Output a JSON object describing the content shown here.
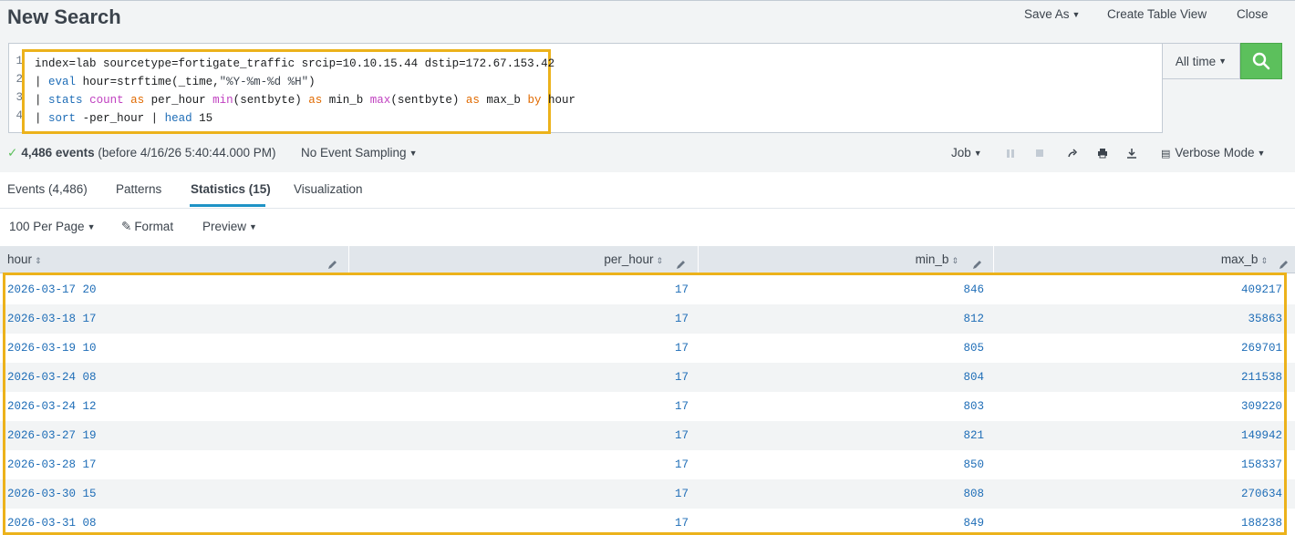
{
  "header": {
    "title": "New Search",
    "save_as": "Save As",
    "create_table_view": "Create Table View",
    "close": "Close"
  },
  "search": {
    "line_numbers": [
      "1",
      "2",
      "3",
      "4"
    ],
    "query_lines": [
      "index=lab sourcetype=fortigate_traffic srcip=10.10.15.44 dstip=172.67.153.42",
      "| eval hour=strftime(_time,\"%Y-%m-%d %H\")",
      "| stats count as per_hour min(sentbyte) as min_b max(sentbyte) as max_b by hour",
      "| sort -per_hour | head 15"
    ],
    "time_range": "All time"
  },
  "status": {
    "event_count": "4,486 events",
    "before": "(before 4/16/26 5:40:44.000 PM)",
    "sampling": "No Event Sampling",
    "job": "Job",
    "mode": "Verbose Mode"
  },
  "tabs": [
    {
      "label": "Events (4,486)",
      "active": false
    },
    {
      "label": "Patterns",
      "active": false
    },
    {
      "label": "Statistics (15)",
      "active": true
    },
    {
      "label": "Visualization",
      "active": false
    }
  ],
  "table_options": {
    "per_page": "100 Per Page",
    "format": "Format",
    "preview": "Preview"
  },
  "table": {
    "columns": [
      "hour",
      "per_hour",
      "min_b",
      "max_b"
    ],
    "rows": [
      [
        "2026-03-17 20",
        "17",
        "846",
        "409217"
      ],
      [
        "2026-03-18 17",
        "17",
        "812",
        "35863"
      ],
      [
        "2026-03-19 10",
        "17",
        "805",
        "269701"
      ],
      [
        "2026-03-24 08",
        "17",
        "804",
        "211538"
      ],
      [
        "2026-03-24 12",
        "17",
        "803",
        "309220"
      ],
      [
        "2026-03-27 19",
        "17",
        "821",
        "149942"
      ],
      [
        "2026-03-28 17",
        "17",
        "850",
        "158337"
      ],
      [
        "2026-03-30 15",
        "17",
        "808",
        "270634"
      ],
      [
        "2026-03-31 08",
        "17",
        "849",
        "188238"
      ]
    ]
  },
  "colors": {
    "accent_highlight": "#ecb21b",
    "search_button": "#5cc05c",
    "link_blue": "#1e6db7",
    "tab_underline": "#1e93c6"
  },
  "icons": [
    "search-icon",
    "check-icon",
    "pause-icon",
    "stop-icon",
    "share-icon",
    "print-icon",
    "download-icon",
    "mode-icon",
    "pencil-icon",
    "sort-icon"
  ]
}
